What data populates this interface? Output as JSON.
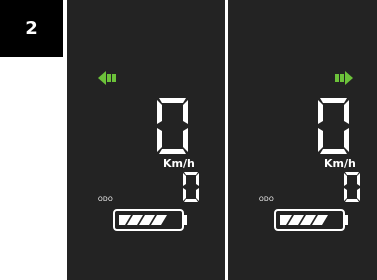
{
  "step": {
    "number": "2"
  },
  "colors": {
    "accent_green": "#6cc23a",
    "panel_bg": "#232323",
    "segment": "#ffffff"
  },
  "panels": [
    {
      "turn_signal": "left-arrow-icon",
      "speed": "0",
      "speed_unit": "Km/h",
      "odo_label": "ODO",
      "odo_value": "0",
      "battery_bars": 4
    },
    {
      "turn_signal": "right-arrow-icon",
      "speed": "0",
      "speed_unit": "Km/h",
      "odo_label": "ODO",
      "odo_value": "0",
      "battery_bars": 4
    }
  ]
}
